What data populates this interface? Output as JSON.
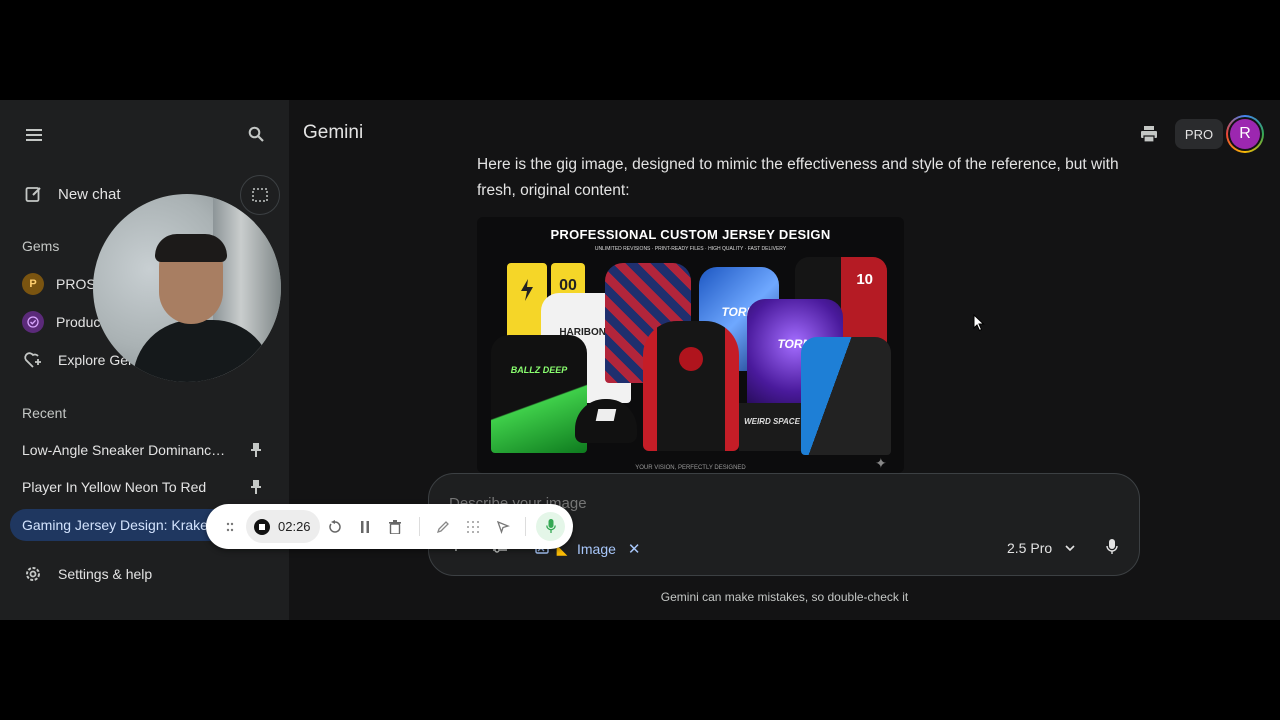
{
  "app": {
    "title": "Gemini",
    "plan_badge": "PRO",
    "avatar_letter": "R"
  },
  "sidebar": {
    "new_chat": "New chat",
    "gems_heading": "Gems",
    "gems": [
      {
        "letter": "P",
        "label": "PROSP"
      },
      {
        "letter": "",
        "label": "Produc"
      }
    ],
    "explore": "Explore Gem",
    "recent_heading": "Recent",
    "recent": [
      "Low-Angle Sneaker Dominance ...",
      "Player In Yellow Neon To Red",
      "Gaming Jersey Design: Kraken"
    ],
    "settings": "Settings & help"
  },
  "message": {
    "line1": "Here is the gig image, designed to mimic the effectiveness and style of the reference, but with",
    "line2": "fresh, original content:"
  },
  "image": {
    "title": "PROFESSIONAL CUSTOM JERSEY DESIGN",
    "subtitle": "UNLIMITED REVISIONS · PRINT-READY FILES · HIGH QUALITY · FAST DELIVERY",
    "tagline": "YOUR VISION, PERFECTLY DESIGNED",
    "jersey_texts": [
      "00",
      "HARIBONS",
      "10",
      "TORM",
      "TORM",
      "BALLZ DEEP",
      "WEIRD SPACE"
    ]
  },
  "input": {
    "placeholder": "Describe your image",
    "chip_label": "Image",
    "model": "2.5 Pro"
  },
  "disclaimer": "Gemini can make mistakes, so double-check it",
  "recorder": {
    "time": "02:26"
  },
  "colors": {
    "accent": "#a8c7fa",
    "mic_green": "#34a853",
    "avatar_ring": "#d05ce3"
  }
}
